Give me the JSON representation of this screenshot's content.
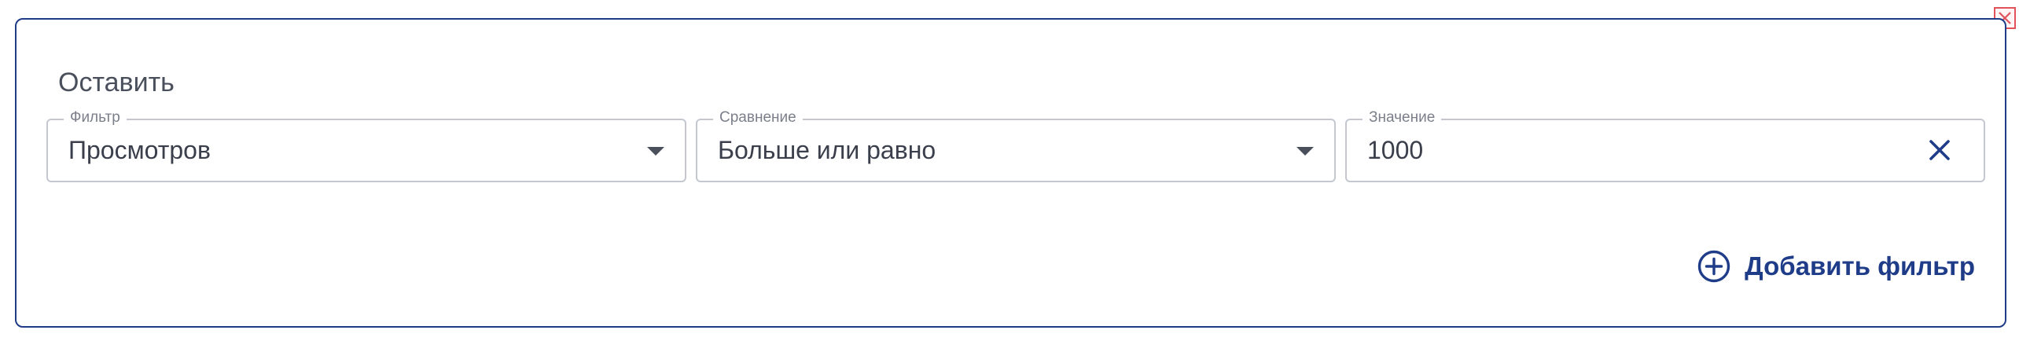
{
  "panel": {
    "title": "Оставить"
  },
  "filters": [
    {
      "label": "Фильтр",
      "value": "Просмотров",
      "icon": "chevron-down-icon"
    },
    {
      "label": "Сравнение",
      "value": "Больше или равно",
      "icon": "chevron-down-icon"
    },
    {
      "label": "Значение",
      "value": "1000",
      "icon": "close-icon"
    }
  ],
  "actions": {
    "add_filter_label": "Добавить фильтр",
    "add_filter_icon": "plus-circle-icon",
    "close_panel_icon": "close-icon"
  },
  "colors": {
    "accent": "#1f3c88",
    "field_border": "#c4c7cf",
    "text": "#3a3f4b",
    "label": "#7b7f8a",
    "close_corner": "#e2525a"
  }
}
